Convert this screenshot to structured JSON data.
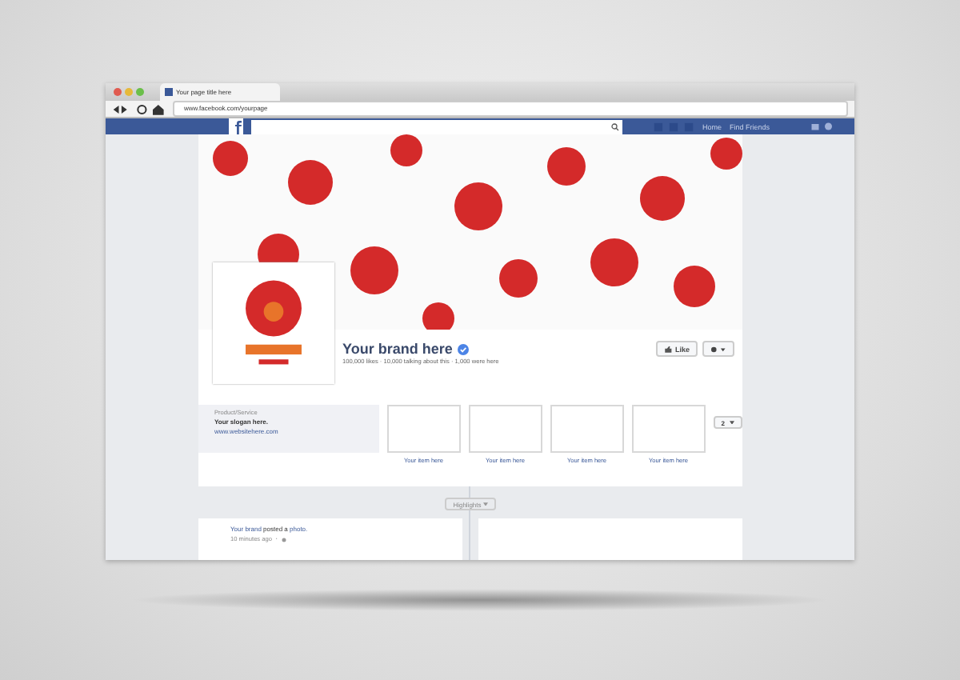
{
  "browser": {
    "tab_title": "Your page title here",
    "url": "www.facebook.com/yourpage"
  },
  "navbar": {
    "links": [
      "Home",
      "Find Friends"
    ]
  },
  "page": {
    "name": "Your brand here",
    "verified": true,
    "stats": "100,000 likes · 10,000 talking about this · 1,000 were here",
    "like_button": "Like",
    "category": "Product/Service",
    "slogan": "Your slogan here.",
    "website": "www.websitehere.com",
    "items": [
      "Your item here",
      "Your item here",
      "Your item here",
      "Your item here"
    ],
    "items_count": "2",
    "highlights": "Highlights",
    "post": {
      "author": "Your brand",
      "action": "posted a",
      "object": "photo.",
      "time": "10 minutes ago",
      "time_separator": "·"
    }
  }
}
